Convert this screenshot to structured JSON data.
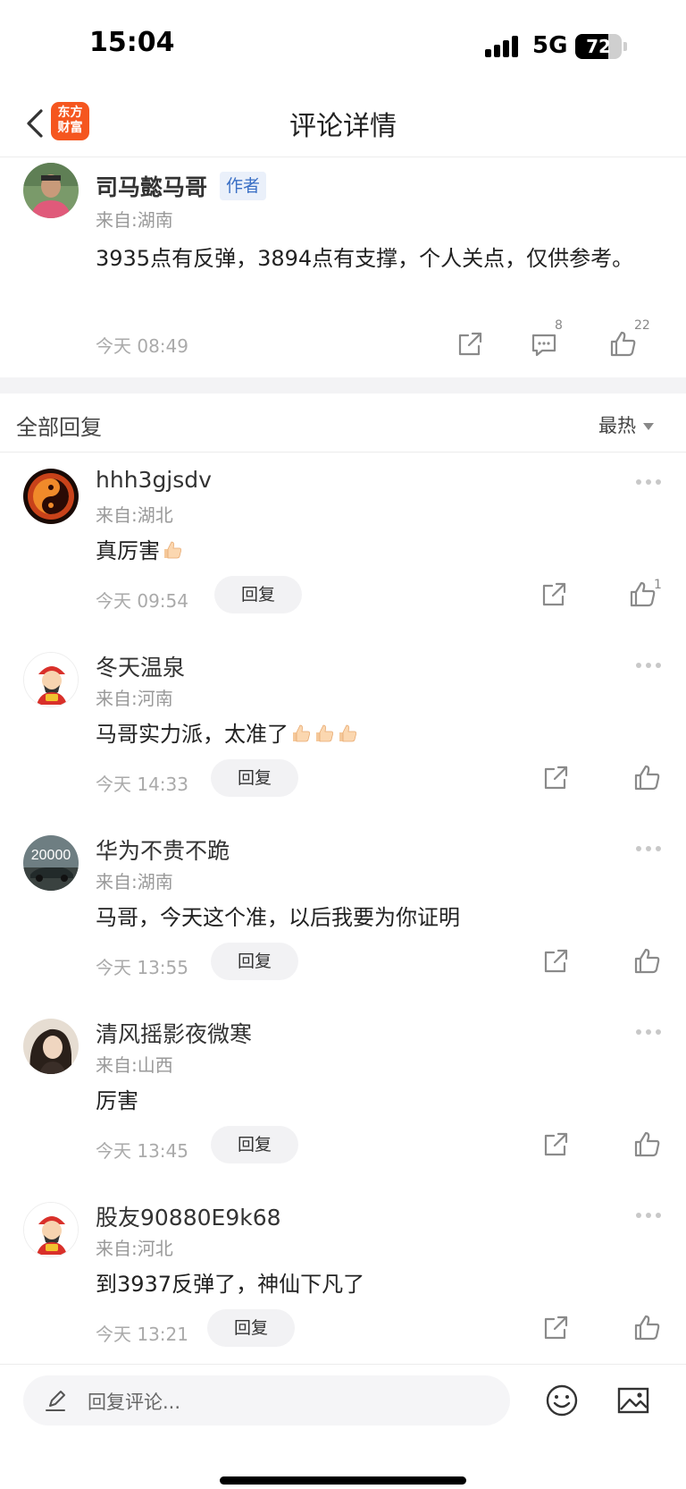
{
  "status_bar": {
    "time": "15:04",
    "network": "5G",
    "battery": "72",
    "battery_level": 0.72
  },
  "nav": {
    "logo_line1": "东方",
    "logo_line2": "财富",
    "title": "评论详情"
  },
  "post": {
    "author": "司马懿马哥",
    "badge": "作者",
    "from": "来自:湖南",
    "body": "3935点有反弹，3894点有支撑，个人关点，仅供参考。",
    "time": "今天 08:49",
    "comment_count": "8",
    "like_count": "22"
  },
  "replies": {
    "title": "全部回复",
    "sort": "最热"
  },
  "comments": [
    {
      "name": "hhh3gjsdv",
      "from": "来自:湖北",
      "text": "真厉害",
      "thumbs": 1,
      "time": "今天 09:54",
      "reply": "回复",
      "likes": "1"
    },
    {
      "name": "冬天温泉",
      "from": "来自:河南",
      "text": "马哥实力派，太准了",
      "thumbs": 3,
      "time": "今天 14:33",
      "reply": "回复",
      "likes": ""
    },
    {
      "name": "华为不贵不跪",
      "from": "来自:湖南",
      "text": "马哥，今天这个准，以后我要为你证明",
      "thumbs": 0,
      "time": "今天 13:55",
      "reply": "回复",
      "likes": ""
    },
    {
      "name": "清风摇影夜微寒",
      "from": "来自:山西",
      "text": "厉害",
      "thumbs": 0,
      "time": "今天 13:45",
      "reply": "回复",
      "likes": ""
    },
    {
      "name": "股友90880E9k68",
      "from": "来自:河北",
      "text": "到3937反弹了，神仙下凡了",
      "thumbs": 0,
      "time": "今天 13:21",
      "reply": "回复",
      "likes": ""
    }
  ],
  "avatar_3_text": "20000",
  "bottom_bar": {
    "placeholder": "回复评论..."
  }
}
